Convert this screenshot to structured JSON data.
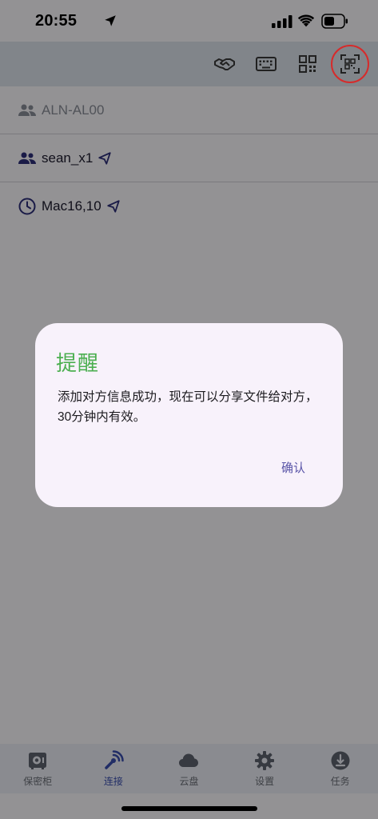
{
  "status_bar": {
    "time": "20:55",
    "icons": [
      "location-arrow-icon",
      "cellular-signal-icon",
      "wifi-icon",
      "battery-icon"
    ]
  },
  "toolbar": {
    "buttons": [
      {
        "name": "handshake-icon"
      },
      {
        "name": "keyboard-icon"
      },
      {
        "name": "qr-code-icon"
      },
      {
        "name": "qr-scan-icon",
        "highlighted": true
      }
    ],
    "annotation_color": "#d62b2b"
  },
  "devices": [
    {
      "icon": "group-icon",
      "label": "ALN-AL00",
      "dimmed": true,
      "sendable": false
    },
    {
      "icon": "group-icon",
      "label": "sean_x1",
      "dimmed": false,
      "sendable": true
    },
    {
      "icon": "clock-icon",
      "label": "Mac16,10",
      "dimmed": false,
      "sendable": true
    }
  ],
  "dialog": {
    "title": "提醒",
    "message": "添加对方信息成功，现在可以分享文件给对方，30分钟内有效。",
    "confirm_label": "确认",
    "title_color": "#4caf50",
    "confirm_color": "#5a55a8"
  },
  "bottom_nav": {
    "items": [
      {
        "label": "保密柜",
        "icon": "safe-icon"
      },
      {
        "label": "连接",
        "icon": "connect-icon",
        "active": true
      },
      {
        "label": "云盘",
        "icon": "cloud-icon"
      },
      {
        "label": "设置",
        "icon": "gear-icon"
      },
      {
        "label": "任务",
        "icon": "task-icon"
      }
    ],
    "active_color": "#3a4fb0"
  }
}
